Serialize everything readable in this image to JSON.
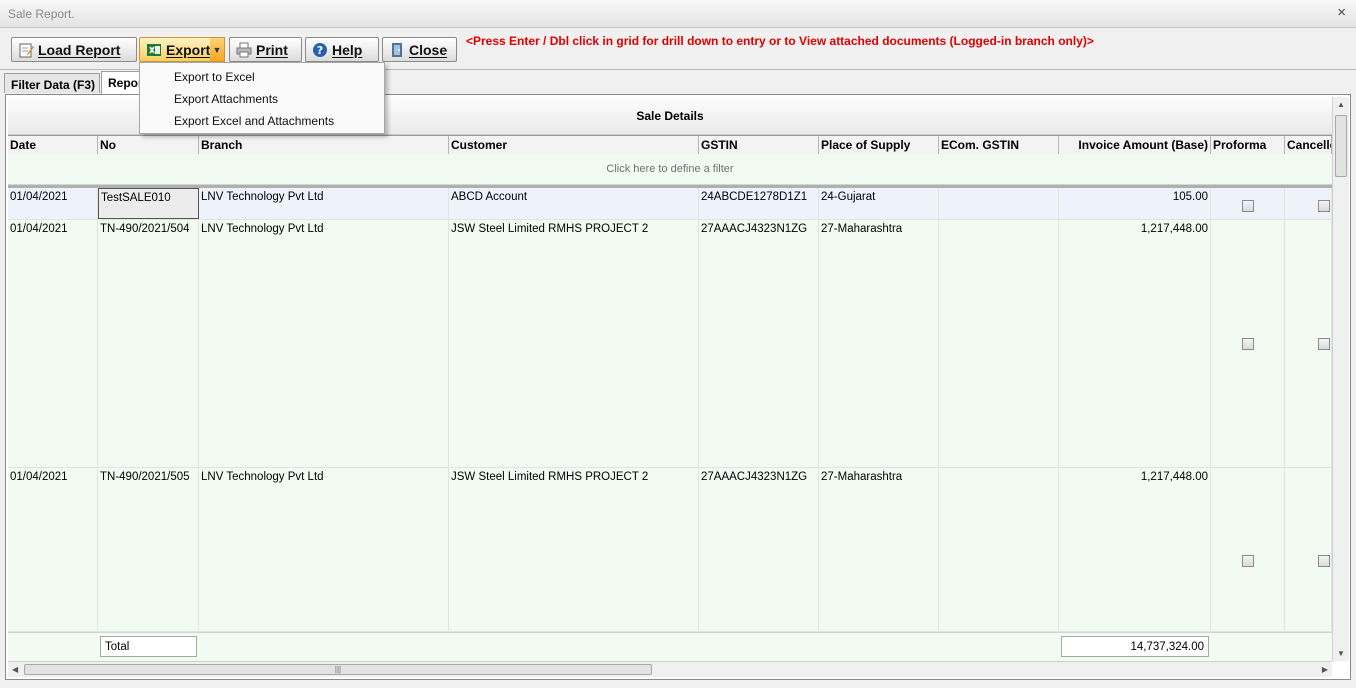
{
  "window": {
    "title": "Sale Report.",
    "close_glyph": "×"
  },
  "toolbar": {
    "load_report": "Load Report",
    "export": "Export",
    "print": "Print",
    "help": "Help",
    "close": "Close",
    "hint": "<Press Enter / Dbl click in grid for drill down to entry or to View attached documents (Logged-in branch only)>"
  },
  "tabs": [
    {
      "label": "Filter Data (F3)"
    },
    {
      "label": "Report"
    }
  ],
  "export_menu": {
    "items": [
      "Export to Excel",
      "Export Attachments",
      "Export Excel and Attachments"
    ]
  },
  "grid": {
    "group_header": "Sale Details",
    "columns": [
      "Date",
      "No",
      "Branch",
      "Customer",
      "GSTIN",
      "Place of Supply",
      "ECom. GSTIN",
      "Invoice Amount (Base)",
      "Proforma",
      "Cancelled"
    ],
    "filter_prompt": "Click here to define a filter",
    "rows": [
      {
        "date": "01/04/2021",
        "no": "TestSALE010",
        "branch": "LNV Technology Pvt Ltd",
        "customer": "ABCD Account",
        "gstin": "24ABCDE1278D1Z1",
        "place": "24-Gujarat",
        "ecom": "",
        "amount": "105.00"
      },
      {
        "date": "01/04/2021",
        "no": "TN-490/2021/504",
        "branch": "LNV Technology Pvt Ltd",
        "customer": "JSW Steel Limited RMHS PROJECT 2",
        "gstin": "27AAACJ4323N1ZG",
        "place": "27-Maharashtra",
        "ecom": "",
        "amount": "1,217,448.00"
      },
      {
        "date": "01/04/2021",
        "no": "TN-490/2021/505",
        "branch": "LNV Technology Pvt Ltd",
        "customer": "JSW Steel Limited RMHS PROJECT 2",
        "gstin": "27AAACJ4323N1ZG",
        "place": "27-Maharashtra",
        "ecom": "",
        "amount": "1,217,448.00"
      }
    ],
    "total_label": "Total",
    "total_amount": "14,737,324.00"
  }
}
